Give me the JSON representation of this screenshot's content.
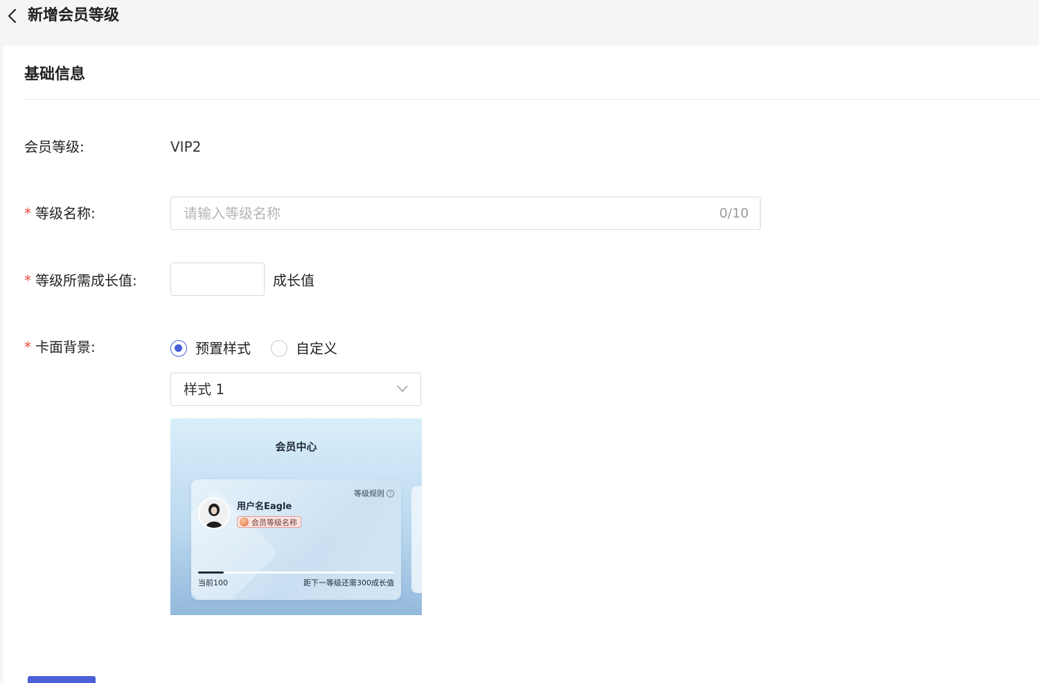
{
  "header": {
    "title": "新增会员等级"
  },
  "section": {
    "title": "基础信息"
  },
  "form": {
    "level": {
      "label": "会员等级:",
      "value": "VIP2"
    },
    "level_name": {
      "required_mark": "*",
      "label": "等级名称:",
      "placeholder": "请输入等级名称",
      "counter": "0/10"
    },
    "growth": {
      "required_mark": "*",
      "label": "等级所需成长值:",
      "value": "",
      "unit": "成长值"
    },
    "card_bg": {
      "required_mark": "*",
      "label": "卡面背景:",
      "options": [
        {
          "label": "预置样式",
          "checked": true
        },
        {
          "label": "自定义",
          "checked": false
        }
      ],
      "style_select": {
        "value": "样式 1",
        "icon": "chevron-down-icon"
      }
    }
  },
  "preview": {
    "title": "会员中心",
    "rules": "等级规则",
    "username": "用户名Eagle",
    "badge": "会员等级名称",
    "progress": {
      "fraction": 0.13
    },
    "current": "当前100",
    "next": "距下一等级还需300成长值"
  },
  "colors": {
    "primary": "#4a5fd8",
    "required": "#e8483b"
  }
}
